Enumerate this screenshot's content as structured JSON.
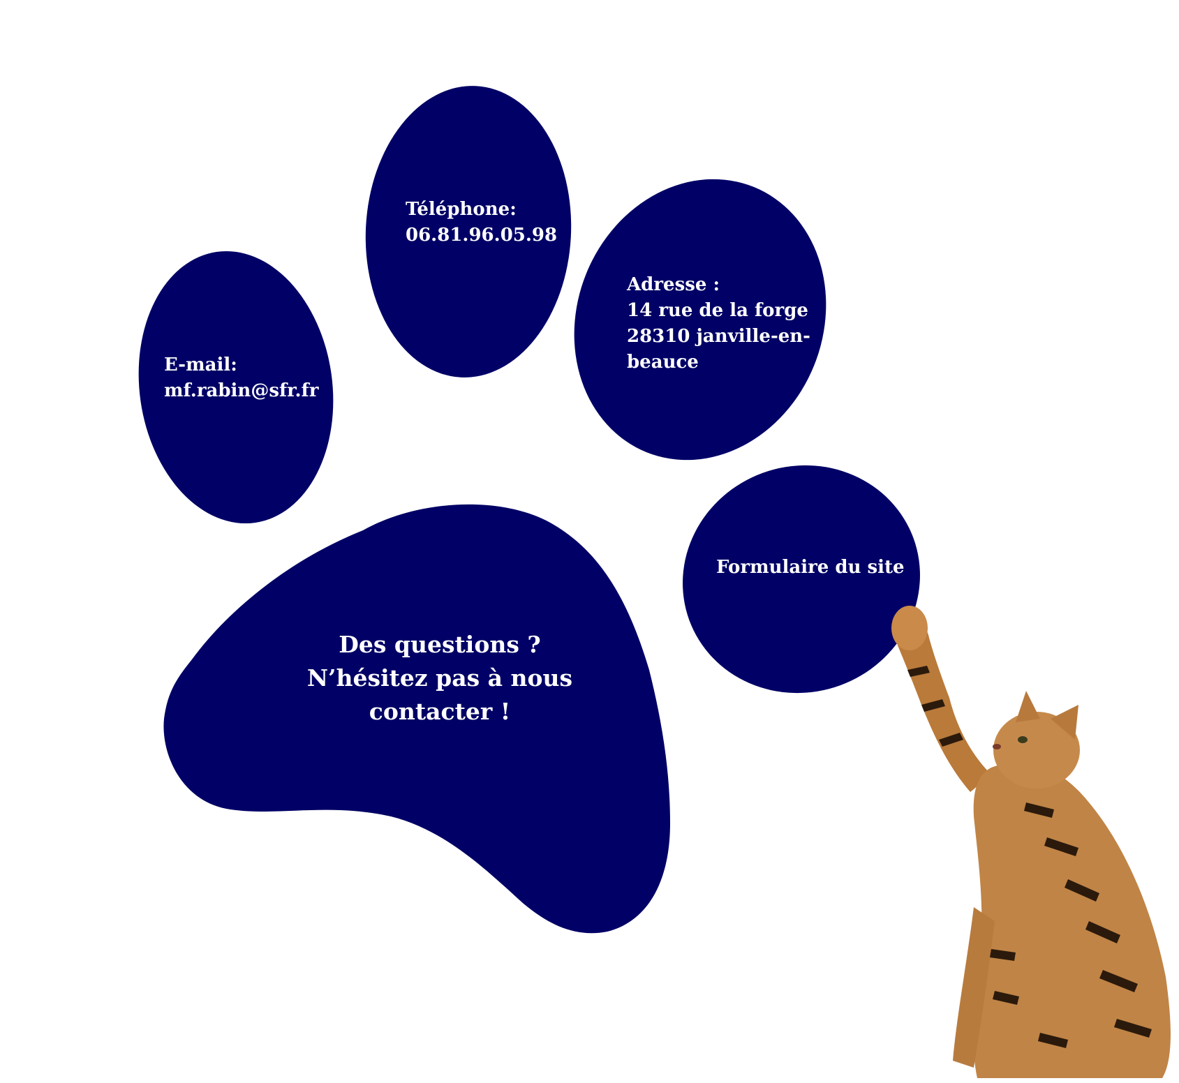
{
  "colors": {
    "paw": "#000066",
    "text": "#ffffff",
    "background": "#ffffff"
  },
  "contact": {
    "email": {
      "label": "E-mail:",
      "value": "mf.rabin@sfr.fr"
    },
    "phone": {
      "label": "Téléphone:",
      "value": "06.81.96.05.98"
    },
    "address": {
      "label": "Adresse :",
      "line1": "14 rue de la forge",
      "line2": "28310 janville-en-",
      "line3": "beauce"
    },
    "form": {
      "label": "Formulaire du site"
    }
  },
  "main": {
    "line1": "Des questions ?",
    "line2": "N’hésitez pas à nous",
    "line3": "contacter !"
  },
  "image": {
    "subject": "bengal-cat-icon"
  }
}
